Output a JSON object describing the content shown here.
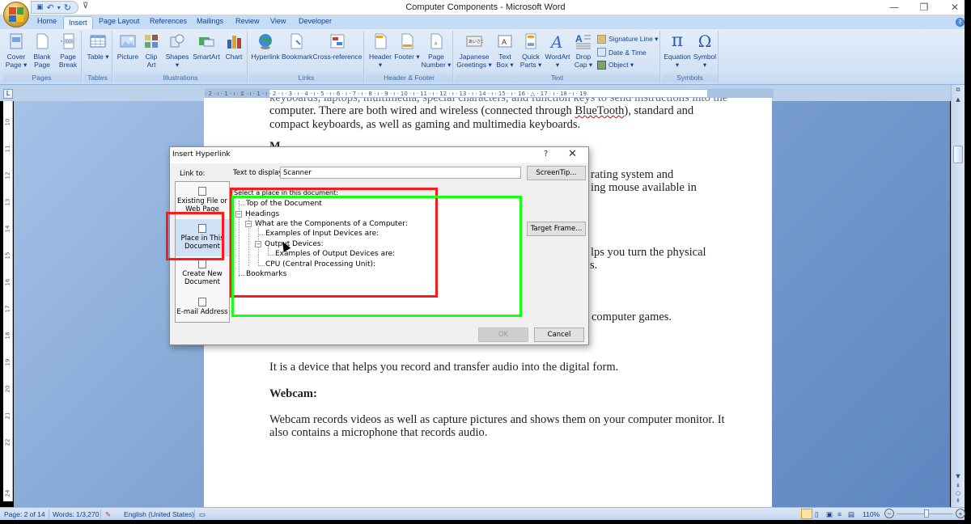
{
  "window": {
    "title": "Computer Components - Microsoft Word",
    "controls": {
      "minimize": "—",
      "restore": "❐",
      "close": "✕"
    }
  },
  "qat": {
    "save": "💾",
    "undo": "↶",
    "undo_more": "▾",
    "redo": "↻",
    "customize": "⩡"
  },
  "ribbon": {
    "tabs": [
      "Home",
      "Insert",
      "Page Layout",
      "References",
      "Mailings",
      "Review",
      "View",
      "Developer"
    ],
    "active_tab": "Insert",
    "groups": {
      "pages": {
        "label": "Pages",
        "buttons": [
          "Cover Page ▾",
          "Blank Page",
          "Page Break"
        ]
      },
      "tables": {
        "label": "Tables",
        "buttons": [
          "Table ▾"
        ]
      },
      "illustrations": {
        "label": "Illustrations",
        "buttons": [
          "Picture",
          "Clip Art",
          "Shapes ▾",
          "SmartArt",
          "Chart"
        ]
      },
      "links": {
        "label": "Links",
        "buttons": [
          "Hyperlink",
          "Bookmark",
          "Cross-reference"
        ]
      },
      "header_footer": {
        "label": "Header & Footer",
        "buttons": [
          "Header ▾",
          "Footer ▾",
          "Page Number ▾"
        ]
      },
      "text": {
        "label": "Text",
        "buttons": [
          "Japanese Greetings ▾",
          "Text Box ▾",
          "Quick Parts ▾",
          "WordArt ▾",
          "Drop Cap ▾"
        ],
        "small_buttons": [
          "Signature Line ▾",
          "Date & Time",
          "Object ▾"
        ]
      },
      "symbols": {
        "label": "Symbols",
        "buttons": [
          "Equation ▾",
          "Symbol ▾"
        ]
      }
    }
  },
  "ruler": {
    "horizontal": "· 2 · ı · 1 · ı · ⧖ · ı · 1 · ı · 2 · ı · 3 · ı · 4 · ı · 5 · ı · 6 · ı · 7 · ı · 8 · ı · 9 · ı · 10 · ı · 11 · ı · 12 · ı · 13 · ı · 14 · ı · 15 · ı · 16 · △ · 17 · ı · 18 · ı · 19",
    "vertical": [
      "10",
      "11",
      "12",
      "13",
      "14",
      "15",
      "16",
      "17",
      "18",
      "19",
      "20",
      "21",
      "22",
      "24"
    ],
    "corner": "L"
  },
  "document": {
    "lines": [
      {
        "text": "computer. There are both wired and wireless (connected through ",
        "spell": "BlueTooth",
        "after": "), standard and"
      },
      {
        "text": "compact keyboards, as well as gaming and multimedia keyboards."
      },
      {
        "text": "rating system and"
      },
      {
        "text": "ing mouse available in"
      },
      {
        "text": "lps you turn the physical"
      },
      {
        "text": "s."
      },
      {
        "text": "computer games."
      },
      {
        "text": "It is a device that helps you record and transfer audio into the digital form."
      },
      {
        "heading": "Webcam:"
      },
      {
        "text": "Webcam records videos as well as capture pictures and shows them on your computer monitor. It"
      },
      {
        "text": "also contains a microphone that records audio."
      }
    ],
    "partial_heading": "M"
  },
  "dialog": {
    "title": "Insert Hyperlink",
    "help": "?",
    "close": "✕",
    "link_to_label": "Link to:",
    "link_to_items": [
      {
        "label": "Existing File or Web Page",
        "selected": false
      },
      {
        "label": "Place in This Document",
        "selected": true
      },
      {
        "label": "Create New Document",
        "selected": false
      },
      {
        "label": "E-mail Address",
        "selected": false
      }
    ],
    "text_to_display_label": "Text to display:",
    "text_to_display_value": "Scanner",
    "screentip_button": "ScreenTip...",
    "select_place_label": "Select a place in this document:",
    "tree": [
      {
        "label": "Top of the Document",
        "level": 0
      },
      {
        "label": "Headings",
        "level": 0,
        "expanded": true
      },
      {
        "label": "What are the Components of a Computer:",
        "level": 1,
        "expanded": true
      },
      {
        "label": "Examples of Input Devices are:",
        "level": 2
      },
      {
        "label": "Output Devices:",
        "level": 2,
        "expanded": true
      },
      {
        "label": "Examples of Output Devices are:",
        "level": 3
      },
      {
        "label": "CPU (Central Processing Unit):",
        "level": 2
      },
      {
        "label": "Bookmarks",
        "level": 0
      }
    ],
    "target_frame_button": "Target Frame...",
    "ok_button": "OK",
    "cancel_button": "Cancel"
  },
  "annotations": {
    "red_color": "#ff1a1a",
    "green_color": "#17ff17"
  },
  "statusbar": {
    "page": "Page: 2 of 14",
    "words": "Words: 1/3,270",
    "language": "English (United States)",
    "zoom": "110%",
    "zoom_level_percent": 110
  }
}
